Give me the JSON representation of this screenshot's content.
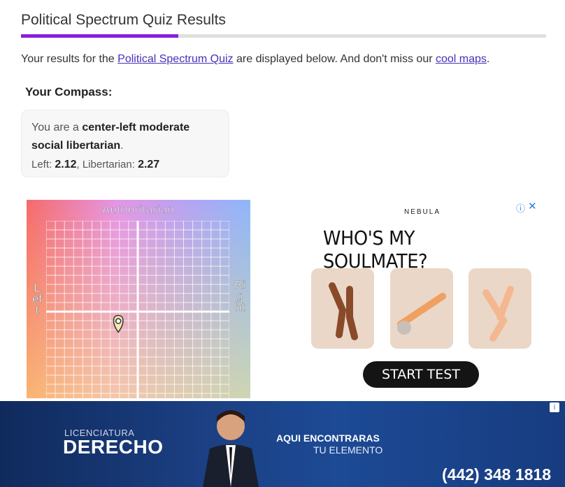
{
  "page": {
    "title": "Political Spectrum Quiz Results",
    "intro_prefix": "Your results for the ",
    "intro_link1": "Political Spectrum Quiz",
    "intro_middle": " are displayed below. And don't miss our ",
    "intro_link2": "cool maps",
    "intro_suffix": ".",
    "progress_fraction": 0.3
  },
  "compass_section": {
    "heading": "Your Compass:",
    "result_prefix": "You are a ",
    "result_label": "center-left moderate social libertarian",
    "result_suffix": ".",
    "left_label": "Left: ",
    "left_value": "2.12",
    "separator": ", ",
    "lib_label": "Libertarian: ",
    "lib_value": "2.27"
  },
  "compass_chart": {
    "top_label": "Authoritarian",
    "left_label": "Left",
    "right_label": "Right",
    "marker_icon": "map-pin-icon"
  },
  "ad_right": {
    "brand": "NEBULA",
    "headline": "WHO'S MY SOULMATE?",
    "cta": "START TEST",
    "info_icon": "info-icon",
    "close_icon": "close-icon"
  },
  "banner_ad": {
    "line1": "LICENCIATURA",
    "line2": "DERECHO",
    "tag1": "AQUI ENCONTRARAS",
    "tag2": "TU ELEMENTO",
    "phone": "(442) 348 1818",
    "info_icon": "info-icon"
  },
  "colors": {
    "accent": "#8a1fdc",
    "link": "#4a2fb8",
    "banner": "#1b3f82"
  }
}
